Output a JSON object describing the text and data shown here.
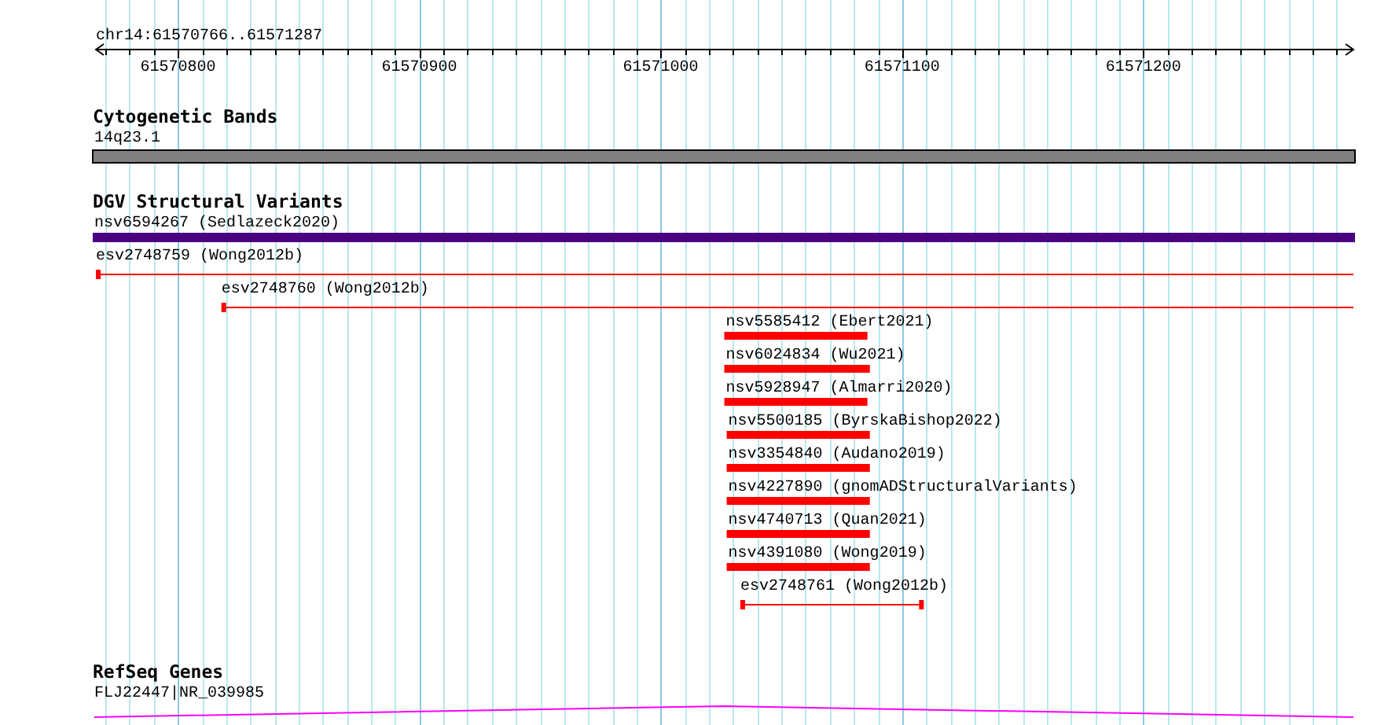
{
  "location": "chr14:61570766..61571287",
  "ruler": {
    "ticks": [
      "61570800",
      "61570900",
      "61571000",
      "61571100",
      "61571200"
    ]
  },
  "tracks": [
    {
      "title": "Cytogenetic Bands",
      "kind": "cytoband",
      "features": [
        {
          "label": "14q23.1",
          "color": "#808080",
          "kind": "band"
        }
      ]
    },
    {
      "title": "DGV Structural Variants",
      "kind": "variants",
      "features": [
        {
          "label": "nsv6594267 (Sedlazeck2020)",
          "color": "#4b0082",
          "kind": "bar"
        },
        {
          "label": "esv2748759 (Wong2012b)",
          "color": "#ff0000",
          "kind": "line"
        },
        {
          "label": "esv2748760 (Wong2012b)",
          "color": "#ff0000",
          "kind": "line"
        },
        {
          "label": "nsv5585412 (Ebert2021)",
          "color": "#ff0000",
          "kind": "bar"
        },
        {
          "label": "nsv6024834 (Wu2021)",
          "color": "#ff0000",
          "kind": "bar"
        },
        {
          "label": "nsv5928947 (Almarri2020)",
          "color": "#ff0000",
          "kind": "bar"
        },
        {
          "label": "nsv5500185 (ByrskaBishop2022)",
          "color": "#ff0000",
          "kind": "bar"
        },
        {
          "label": "nsv3354840 (Audano2019)",
          "color": "#ff0000",
          "kind": "bar"
        },
        {
          "label": "nsv4227890 (gnomADStructuralVariants)",
          "color": "#ff0000",
          "kind": "bar"
        },
        {
          "label": "nsv4740713 (Quan2021)",
          "color": "#ff0000",
          "kind": "bar"
        },
        {
          "label": "nsv4391080 (Wong2019)",
          "color": "#ff0000",
          "kind": "bar"
        },
        {
          "label": "esv2748761 (Wong2012b)",
          "color": "#ff0000",
          "kind": "line"
        }
      ]
    },
    {
      "title": "RefSeq Genes",
      "kind": "genes",
      "features": [
        {
          "label": "FLJ22447|NR_039985",
          "color": "#ff00ff",
          "kind": "intron"
        }
      ]
    }
  ]
}
